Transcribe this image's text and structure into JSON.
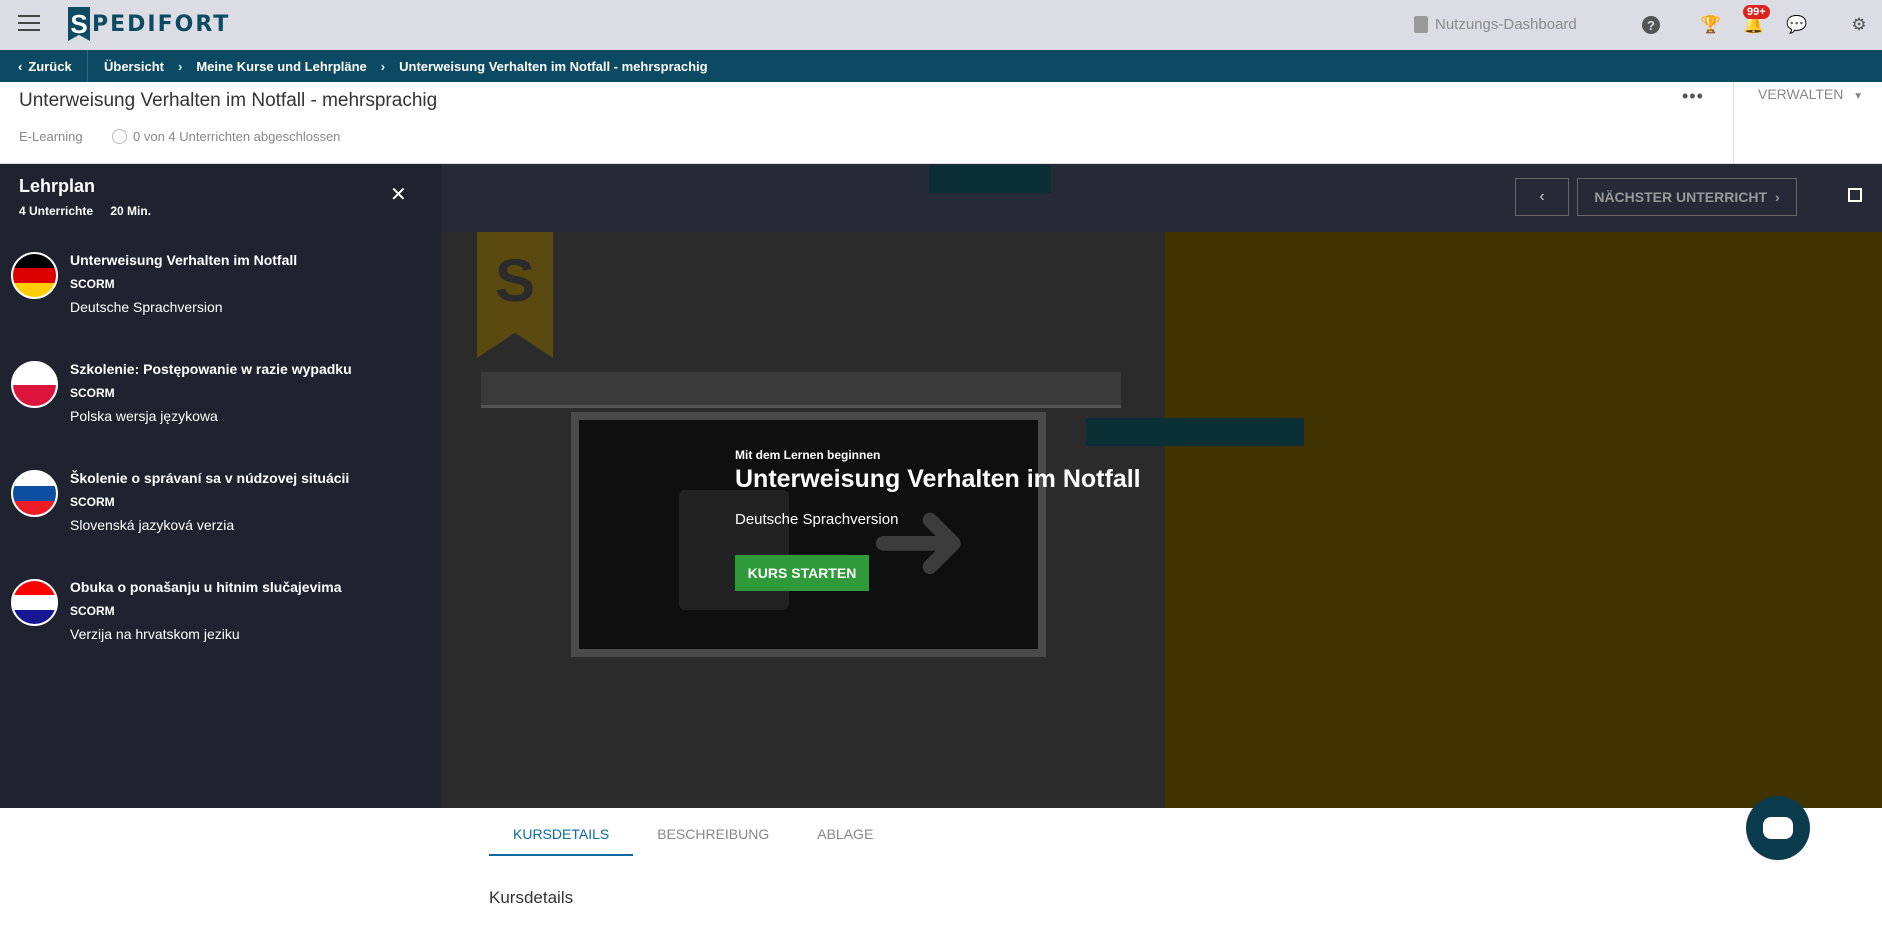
{
  "topbar": {
    "logo_text": "PEDIFORT",
    "logo_letter": "S",
    "dashboard_label": "Nutzungs-Dashboard",
    "notification_count": "99+",
    "icons": [
      "menu-icon",
      "clipboard-icon",
      "help-icon",
      "trophy-icon",
      "bell-icon",
      "chat-icon",
      "gear-icon"
    ]
  },
  "breadcrumb": {
    "back_label": "Zurück",
    "items": [
      "Übersicht",
      "Meine Kurse und Lehrpläne",
      "Unterweisung Verhalten im Notfall - mehrsprachig"
    ]
  },
  "header": {
    "title": "Unterweisung Verhalten im Notfall - mehrsprachig",
    "type": "E-Learning",
    "progress": "0 von 4 Unterrichten abgeschlossen",
    "manage_label": "VERWALTEN"
  },
  "sidebar": {
    "title": "Lehrplan",
    "lessons_count": "4 Unterrichte",
    "duration": "20 Min.",
    "lessons": [
      {
        "title": "Unterweisung Verhalten im Notfall",
        "type": "SCORM",
        "desc": "Deutsche Sprachversion",
        "flag": "de"
      },
      {
        "title": "Szkolenie: Postępowanie w razie wypadku",
        "type": "SCORM",
        "desc": "Polska wersja językowa",
        "flag": "pl"
      },
      {
        "title": "Školenie o správaní sa v núdzovej situácii",
        "type": "SCORM",
        "desc": "Slovenská jazyková verzia",
        "flag": "sk"
      },
      {
        "title": "Obuka o ponašanju u hitnim slučajevima",
        "type": "SCORM",
        "desc": "Verzija na hrvatskom jeziku",
        "flag": "hr"
      }
    ]
  },
  "player": {
    "next_label": "NÄCHSTER UNTERRICHT",
    "pre_title": "Mit dem Lernen beginnen",
    "title": "Unterweisung Verhalten im Notfall",
    "desc": "Deutsche Sprachversion",
    "start_label": "KURS STARTEN"
  },
  "tabs": [
    "KURSDETAILS",
    "BESCHREIBUNG",
    "ABLAGE"
  ],
  "section_title": "Kursdetails",
  "colors": {
    "brand": "#0b4a62",
    "start": "#2f9a3a",
    "badge": "#e0221f",
    "active_tab": "#0b6aa7"
  }
}
